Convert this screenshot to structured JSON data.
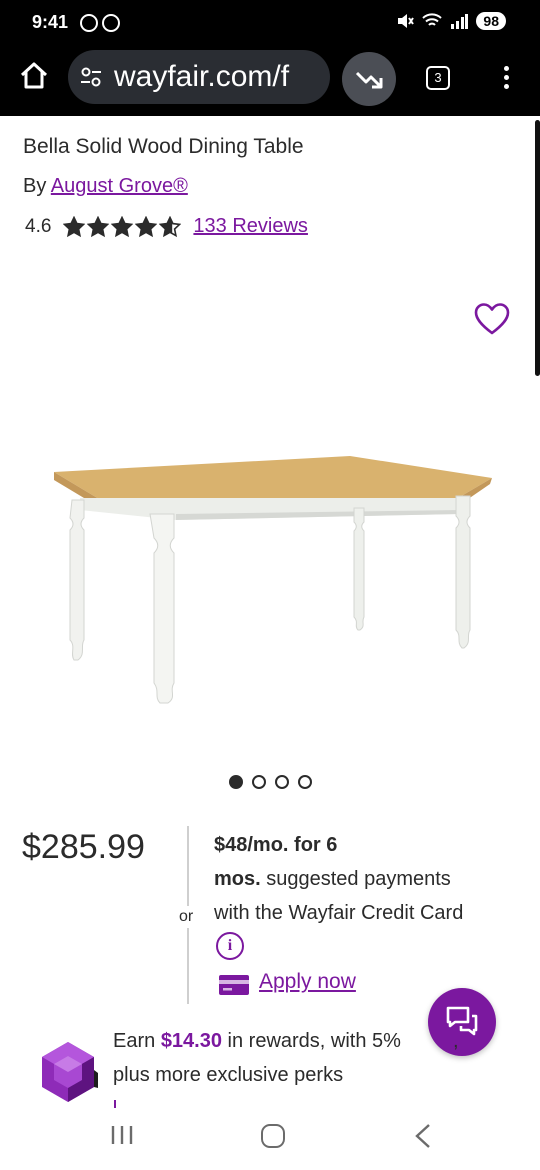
{
  "status_bar": {
    "time": "9:41",
    "battery": "98"
  },
  "browser": {
    "url": "wayfair.com/f",
    "tab_count": "3"
  },
  "product": {
    "title": "Bella Solid Wood Dining Table",
    "by_prefix": "By",
    "brand": "August Grove®",
    "rating": "4.6",
    "rating_value": 4.6,
    "rating_max": 5,
    "reviews_label": "133 Reviews",
    "image_count": 4,
    "active_image": 1
  },
  "pricing": {
    "price": "$285.99",
    "or_label": "or",
    "monthly_bold_1": "$48/mo. for 6",
    "monthly_bold_2": "mos.",
    "monthly_text": " suggested payments",
    "monthly_text_2": "with the Wayfair Credit Card",
    "info_glyph": "i",
    "apply_label": "Apply now"
  },
  "rewards": {
    "prefix": "Earn ",
    "amount": "$14.30",
    "suffix": " in rewards, with 5%",
    "line2": "plus more exclusive perks",
    "trailing": ","
  },
  "colors": {
    "accent": "#7b189f",
    "text": "#2b2b2b",
    "chrome": "#000000"
  },
  "icons": {
    "home": "home-icon",
    "site_settings": "site-settings-icon",
    "trend": "trending-down-icon",
    "tabs": "tabs-icon",
    "menu": "more-vert-icon",
    "favorite": "heart-icon",
    "info": "info-icon",
    "card": "credit-card-icon",
    "chat": "chat-icon",
    "rewards": "gem-icon"
  }
}
